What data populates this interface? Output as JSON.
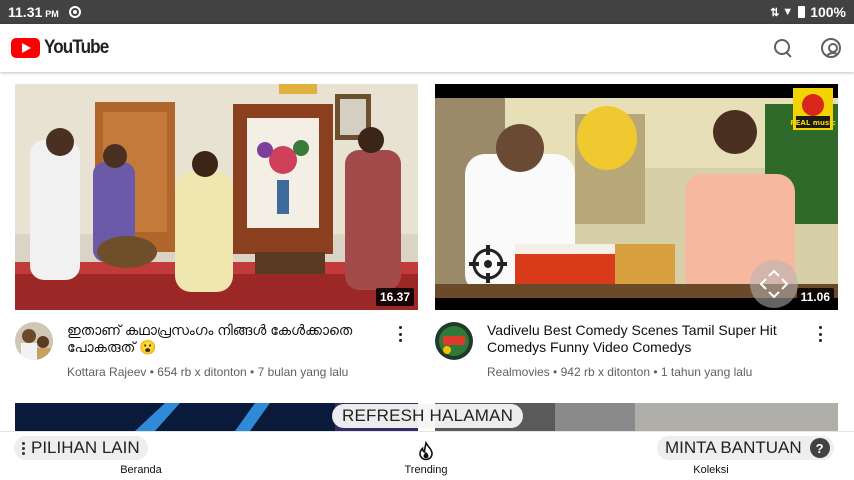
{
  "status_bar": {
    "time": "11.31",
    "ampm": "PM",
    "battery": "100%"
  },
  "app": {
    "brand": "YouTube"
  },
  "videos": [
    {
      "title": "ഇതാണ് കഥാപ്രസംഗം നിങ്ങൾ കേൾക്കാതെ പോകരുത് 😮",
      "channel": "Kottara Rajeev",
      "views": "654 rb x ditonton",
      "age": "7 bulan yang lalu",
      "duration": "16.37"
    },
    {
      "title": "Vadivelu Best Comedy Scenes Tamil Super Hit Comedys Funny Video Comedys",
      "channel": "Realmovies",
      "views": "942 rb x ditonton",
      "age": "1 tahun yang lalu",
      "duration": "11.06",
      "badge": "REAL music"
    }
  ],
  "separator": "•",
  "overlay": {
    "refresh": "REFRESH HALAMAN",
    "more_options": "PILIHAN LAIN",
    "help": "MINTA BANTUAN",
    "help_symbol": "?"
  },
  "bottom_nav": {
    "home": "Beranda",
    "trending": "Trending",
    "library": "Koleksi"
  },
  "colors": {
    "brand_red": "#ff0000",
    "status_bar": "#424242",
    "text_secondary": "#606060"
  }
}
